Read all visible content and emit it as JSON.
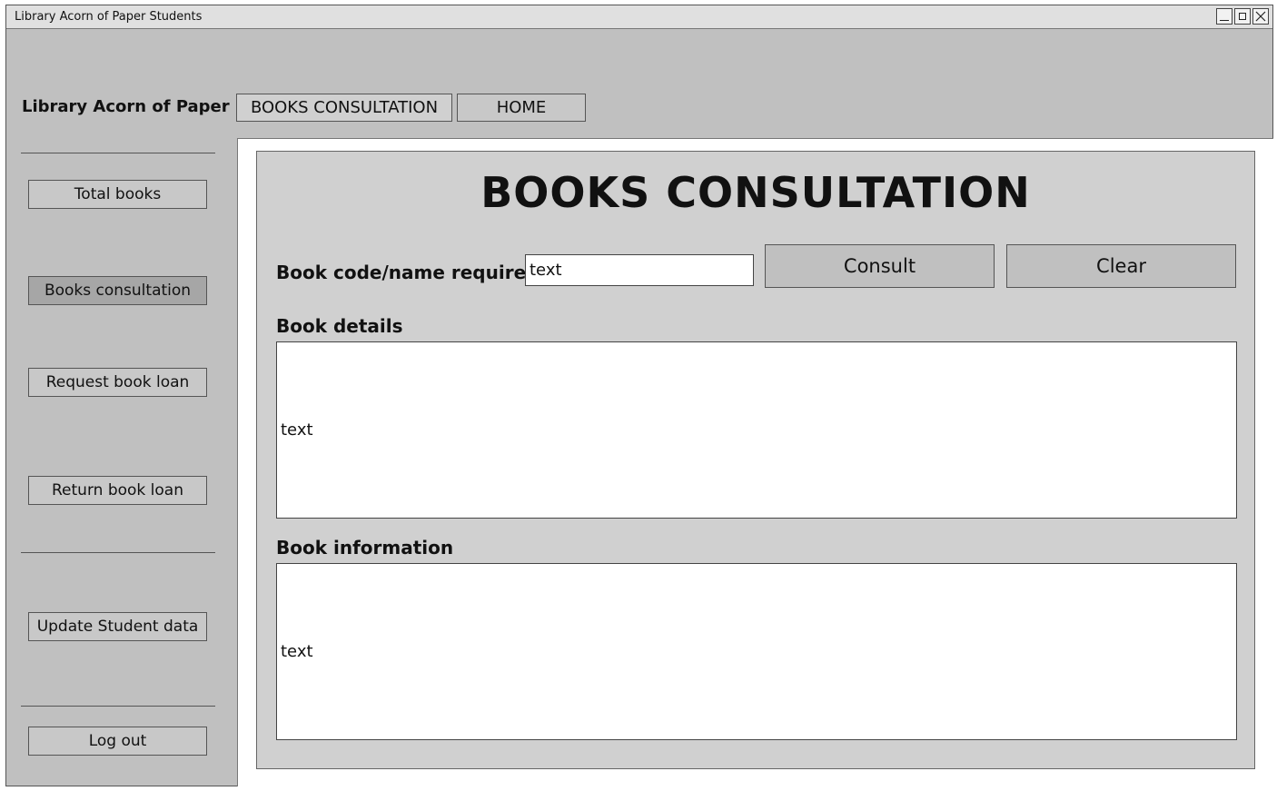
{
  "window": {
    "title": "Library Acorn of Paper Students"
  },
  "header": {
    "brand": "Library Acorn of Paper",
    "nav": [
      {
        "label": "BOOKS CONSULTATION"
      },
      {
        "label": "HOME"
      }
    ]
  },
  "sidebar": {
    "items": [
      {
        "label": "Total books"
      },
      {
        "label": "Books consultation",
        "selected": true
      },
      {
        "label": "Request book loan"
      },
      {
        "label": "Return book loan"
      },
      {
        "label": "Update Student data"
      },
      {
        "label": "Log out"
      }
    ]
  },
  "main": {
    "title": "BOOKS CONSULTATION",
    "search": {
      "label": "Book code/name required",
      "value": "text"
    },
    "buttons": {
      "consult": "Consult",
      "clear": "Clear"
    },
    "book_details": {
      "label": "Book details",
      "value": "text"
    },
    "book_information": {
      "label": "Book information",
      "value": "text"
    }
  }
}
